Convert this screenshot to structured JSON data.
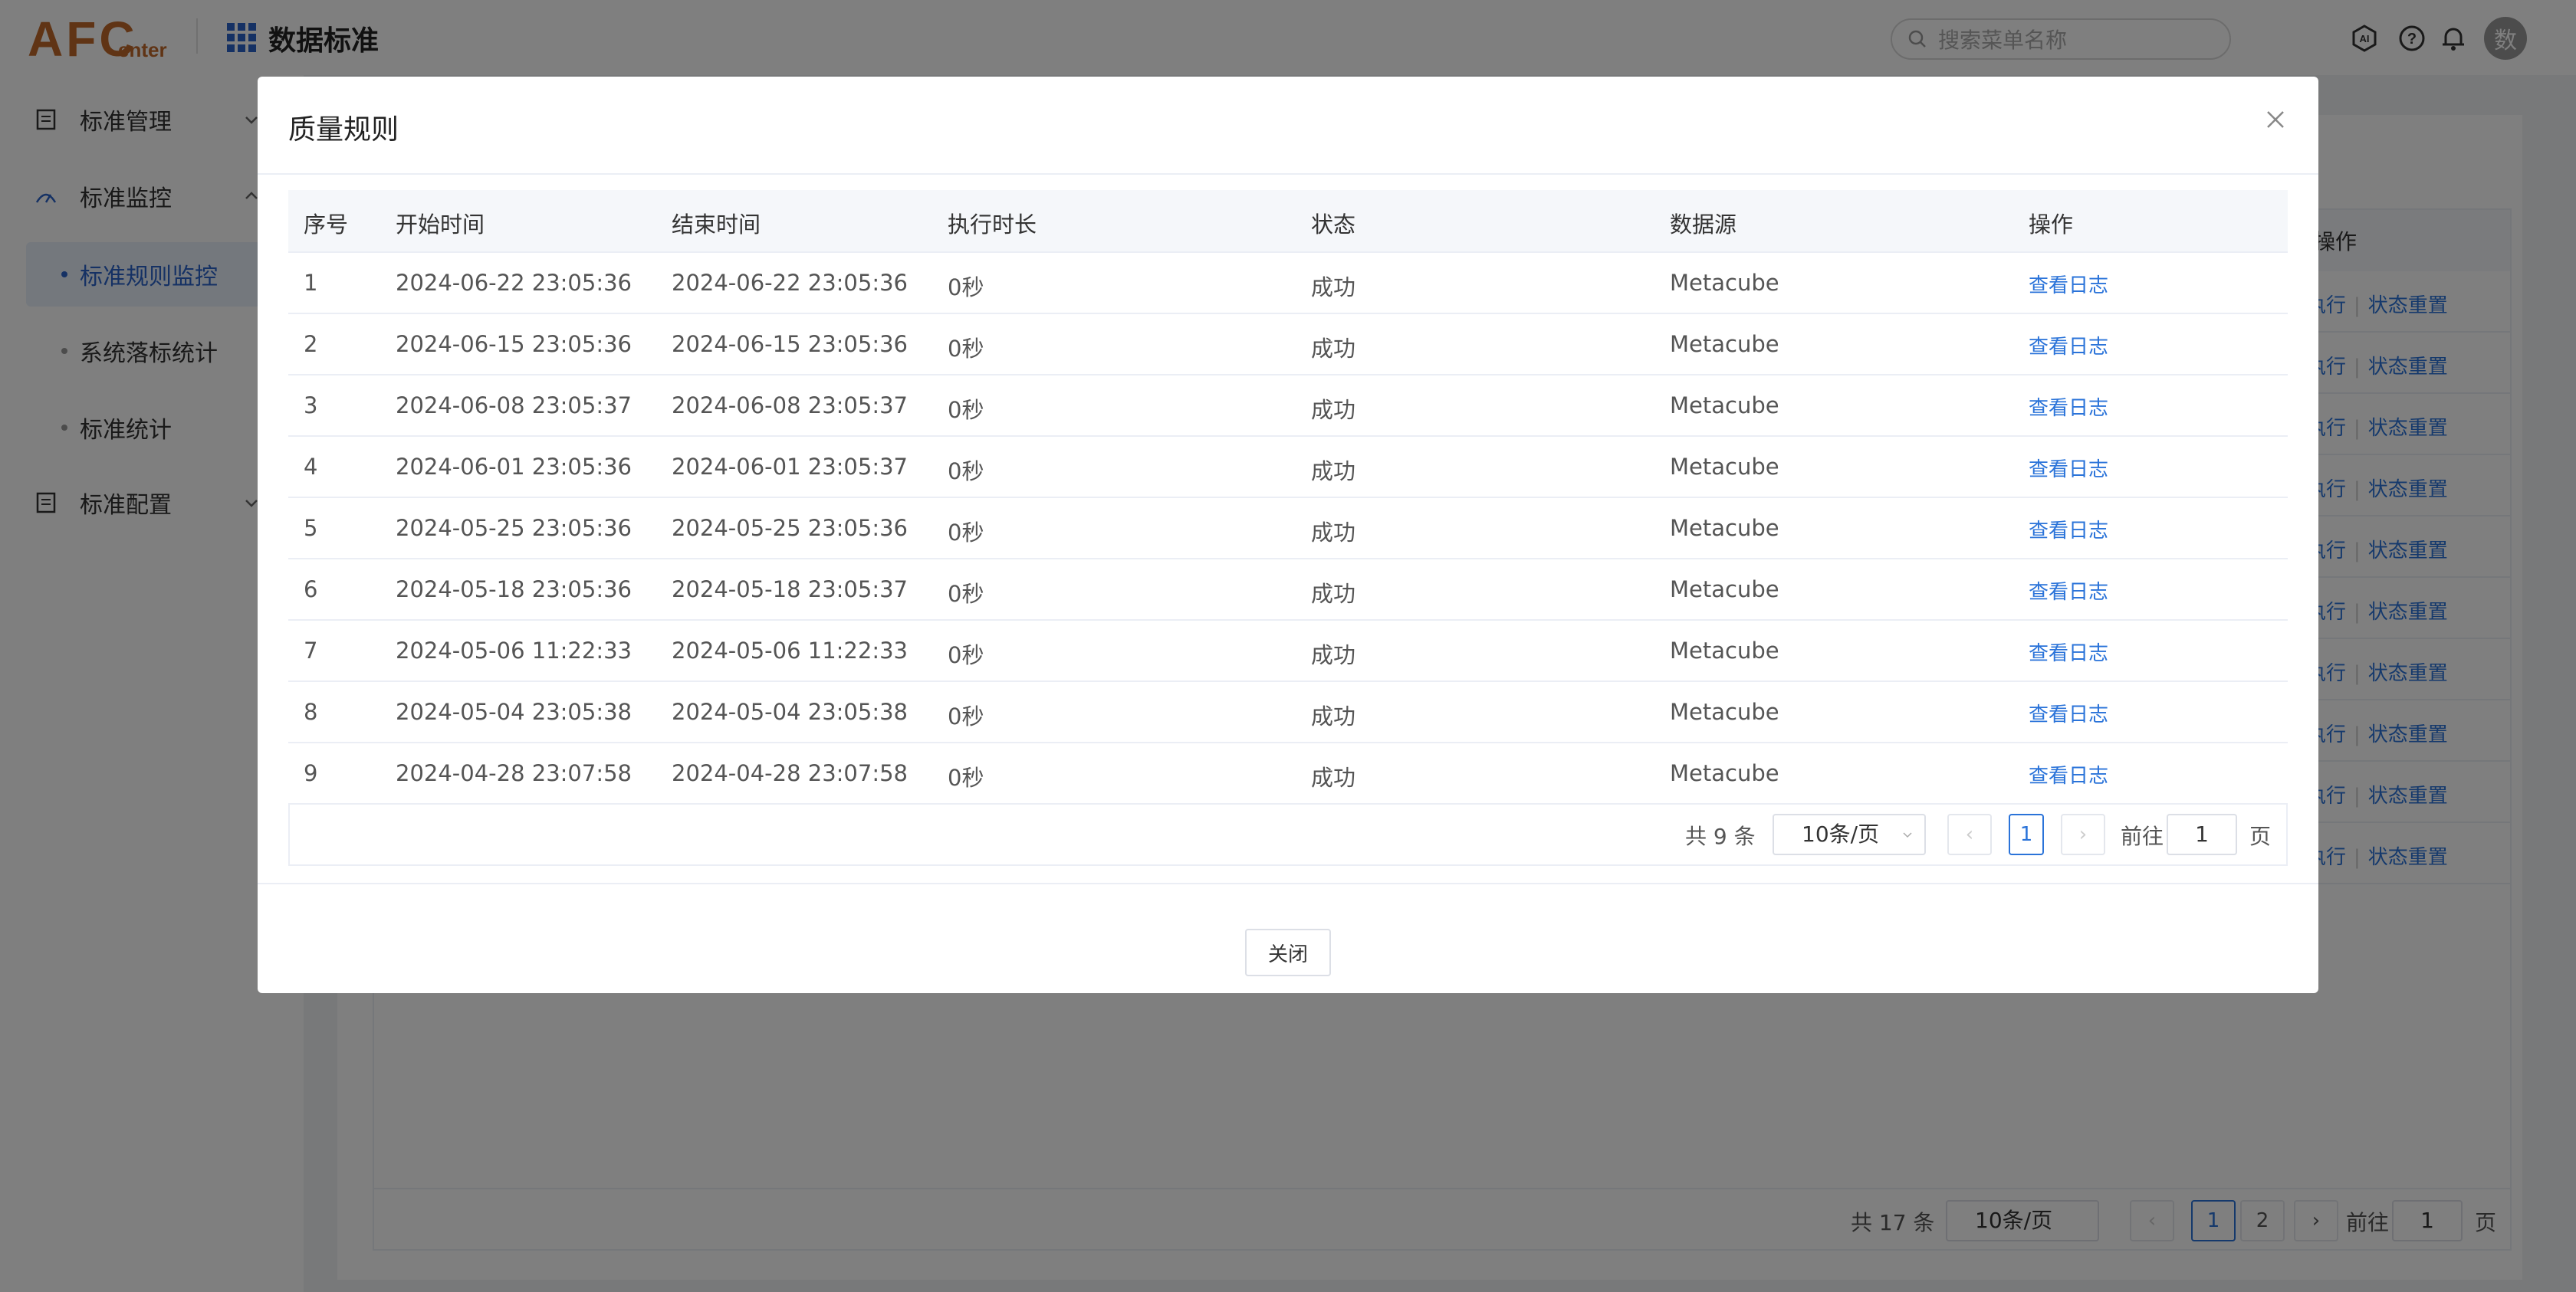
{
  "header": {
    "logo_main": "AFC",
    "logo_sub": "enter",
    "app_title": "数据标准",
    "search_placeholder": "搜索菜单名称",
    "avatar_text": "数"
  },
  "sidebar": {
    "items": [
      {
        "label": "标准管理"
      },
      {
        "label": "标准监控"
      },
      {
        "label": "标准规则监控"
      },
      {
        "label": "系统落标统计"
      },
      {
        "label": "标准统计"
      },
      {
        "label": "标准配置"
      }
    ]
  },
  "background": {
    "op_header": "操作",
    "row_links": [
      "执行",
      "状态重置"
    ],
    "pager": {
      "total": "共 17 条",
      "size": "10条/页",
      "pages": [
        "1",
        "2"
      ],
      "goto": "前往",
      "goto_value": "1",
      "unit": "页"
    }
  },
  "dialog": {
    "title": "质量规则",
    "columns": [
      "序号",
      "开始时间",
      "结束时间",
      "执行时长",
      "状态",
      "数据源",
      "操作"
    ],
    "rows": [
      [
        "1",
        "2024-06-22 23:05:36",
        "2024-06-22 23:05:36",
        "0秒",
        "成功",
        "Metacube",
        "查看日志"
      ],
      [
        "2",
        "2024-06-15 23:05:36",
        "2024-06-15 23:05:36",
        "0秒",
        "成功",
        "Metacube",
        "查看日志"
      ],
      [
        "3",
        "2024-06-08 23:05:37",
        "2024-06-08 23:05:37",
        "0秒",
        "成功",
        "Metacube",
        "查看日志"
      ],
      [
        "4",
        "2024-06-01 23:05:36",
        "2024-06-01 23:05:37",
        "0秒",
        "成功",
        "Metacube",
        "查看日志"
      ],
      [
        "5",
        "2024-05-25 23:05:36",
        "2024-05-25 23:05:36",
        "0秒",
        "成功",
        "Metacube",
        "查看日志"
      ],
      [
        "6",
        "2024-05-18 23:05:36",
        "2024-05-18 23:05:37",
        "0秒",
        "成功",
        "Metacube",
        "查看日志"
      ],
      [
        "7",
        "2024-05-06 11:22:33",
        "2024-05-06 11:22:33",
        "0秒",
        "成功",
        "Metacube",
        "查看日志"
      ],
      [
        "8",
        "2024-05-04 23:05:38",
        "2024-05-04 23:05:38",
        "0秒",
        "成功",
        "Metacube",
        "查看日志"
      ],
      [
        "9",
        "2024-04-28 23:07:58",
        "2024-04-28 23:07:58",
        "0秒",
        "成功",
        "Metacube",
        "查看日志"
      ]
    ],
    "pager": {
      "total": "共 9 条",
      "size": "10条/页",
      "current": "1",
      "goto": "前往",
      "goto_value": "1",
      "unit": "页"
    },
    "close_button": "关闭"
  },
  "colors": {
    "accent": "#2a73d9",
    "logo": "#c0692a"
  }
}
